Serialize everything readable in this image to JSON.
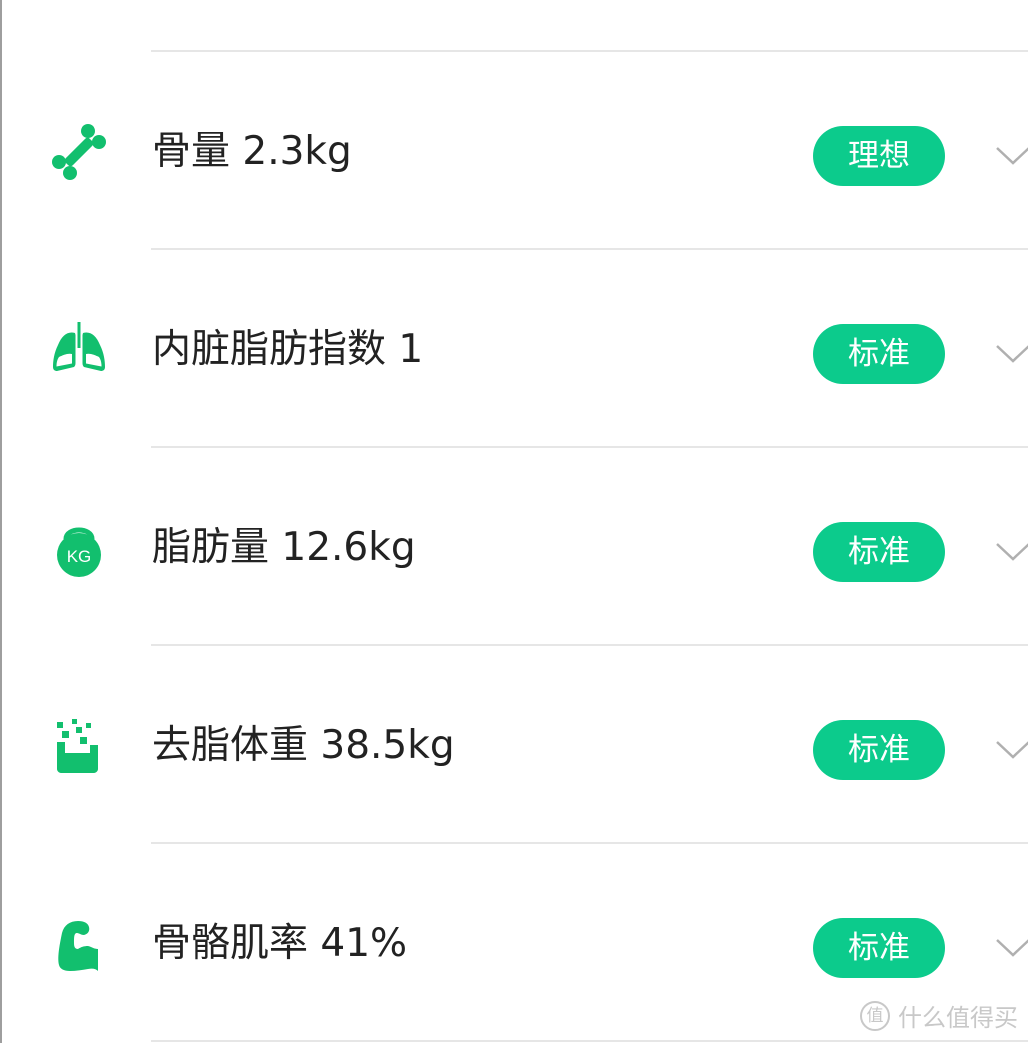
{
  "colors": {
    "accent": "#0ccb8c",
    "icon_green": "#12bf6e",
    "text": "#222222",
    "divider": "#e6e6e6"
  },
  "items": [
    {
      "icon": "bone-icon",
      "label": "骨量 2.3kg",
      "badge": "理想"
    },
    {
      "icon": "lungs-icon",
      "label": "内脏脂肪指数 1",
      "badge": "标准"
    },
    {
      "icon": "kettlebell-kg-icon",
      "label": "脂肪量 12.6kg",
      "badge": "标准"
    },
    {
      "icon": "fat-free-mass-icon",
      "label": "去脂体重 38.5kg",
      "badge": "标准"
    },
    {
      "icon": "muscle-arm-icon",
      "label": "骨骼肌率 41%",
      "badge": "标准"
    }
  ],
  "watermark": {
    "logo": "值",
    "text": "什么值得买"
  },
  "kettlebell_text": "KG"
}
